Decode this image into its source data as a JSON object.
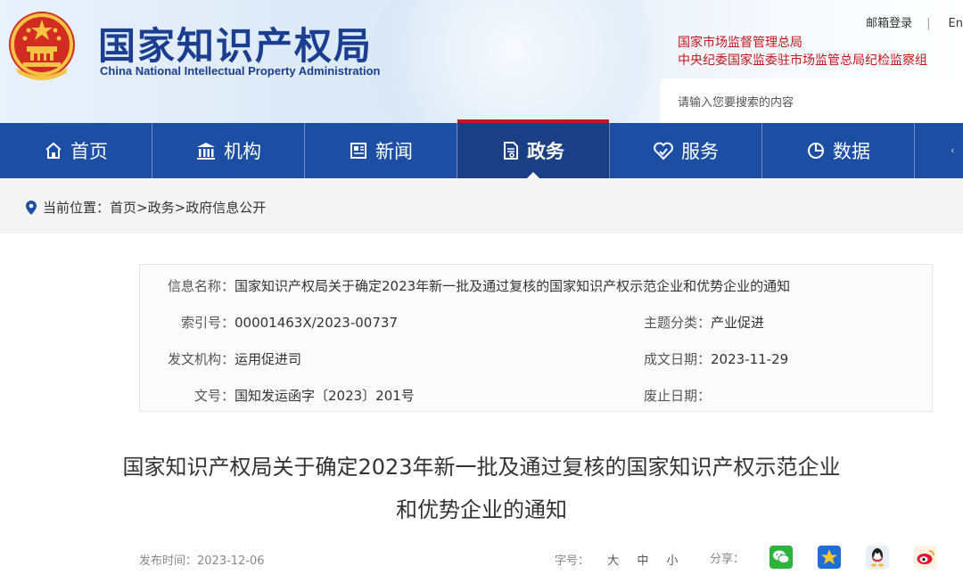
{
  "header": {
    "title": "国家知识产权局",
    "subtitle": "China National Intellectual Property Administration",
    "top_links": {
      "mail_login": "邮箱登录",
      "english": "En"
    },
    "related_sites": [
      "国家市场监督管理总局",
      "中央纪委国家监委驻市场监管总局纪检监察组"
    ],
    "search_placeholder": "请输入您要搜索的内容"
  },
  "nav": {
    "items": [
      {
        "label": "首页",
        "icon": "home-icon"
      },
      {
        "label": "机构",
        "icon": "institution-icon"
      },
      {
        "label": "新闻",
        "icon": "news-icon"
      },
      {
        "label": "政务",
        "icon": "document-icon",
        "active": true
      },
      {
        "label": "服务",
        "icon": "service-heart-icon"
      },
      {
        "label": "数据",
        "icon": "pie-chart-icon"
      }
    ]
  },
  "breadcrumb": {
    "prefix": "当前位置：",
    "items": [
      "首页",
      ">",
      "政务",
      ">",
      "政府信息公开"
    ]
  },
  "info": {
    "name_label": "信息名称：",
    "name_value": "国家知识产权局关于确定2023年新一批及通过复核的国家知识产权示范企业和优势企业的通知",
    "index_label": "索引号：",
    "index_value": "00001463X/2023-00737",
    "topic_label": "主题分类：",
    "topic_value": "产业促进",
    "org_label": "发文机构：",
    "org_value": "运用促进司",
    "date_label": "成文日期：",
    "date_value": "2023-11-29",
    "doc_no_label": "文号：",
    "doc_no_value": "国知发运函字〔2023〕201号",
    "expiry_label": "废止日期：",
    "expiry_value": ""
  },
  "document": {
    "title_line1": "国家知识产权局关于确定2023年新一批及通过复核的国家知识产权示范企业",
    "title_line2": "和优势企业的通知",
    "publish_label": "发布时间：",
    "publish_date": "2023-12-06",
    "font_size_label": "字号：",
    "font_sizes": [
      "大",
      "中",
      "小"
    ],
    "share_label": "分享："
  },
  "colors": {
    "nav_blue": "#1c4fa4",
    "nav_active": "#1a3f85",
    "accent_red": "#c8161d",
    "title_blue": "#1a3f91"
  }
}
